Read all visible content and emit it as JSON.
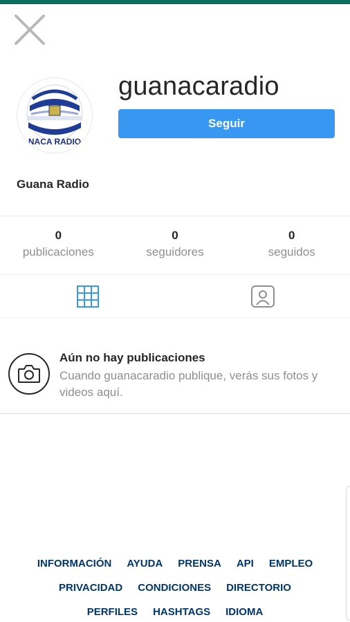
{
  "header": {
    "close_icon": "close-icon"
  },
  "profile": {
    "username": "guanacaradio",
    "follow_label": "Seguir",
    "full_name": "Guana Radio",
    "avatar_text": "NACA RADIO"
  },
  "stats": [
    {
      "value": "0",
      "label": "publicaciones"
    },
    {
      "value": "0",
      "label": "seguidores"
    },
    {
      "value": "0",
      "label": "seguidos"
    }
  ],
  "tabs": [
    {
      "icon": "grid-icon",
      "active": true
    },
    {
      "icon": "tagged-icon",
      "active": false
    }
  ],
  "empty_state": {
    "icon": "camera-icon",
    "title": "Aún no hay publicaciones",
    "description": "Cuando guanacaradio publique, verás sus fotos y videos aquí."
  },
  "footer": {
    "rows": [
      [
        "INFORMACIÓN",
        "AYUDA",
        "PRENSA",
        "API",
        "EMPLEO"
      ],
      [
        "PRIVACIDAD",
        "CONDICIONES",
        "DIRECTORIO"
      ],
      [
        "PERFILES",
        "HASHTAGS",
        "IDIOMA"
      ]
    ]
  },
  "colors": {
    "accent": "#3897f0",
    "top_bar": "#0b6e5c",
    "link": "#003569",
    "muted": "#8e8e8e"
  }
}
